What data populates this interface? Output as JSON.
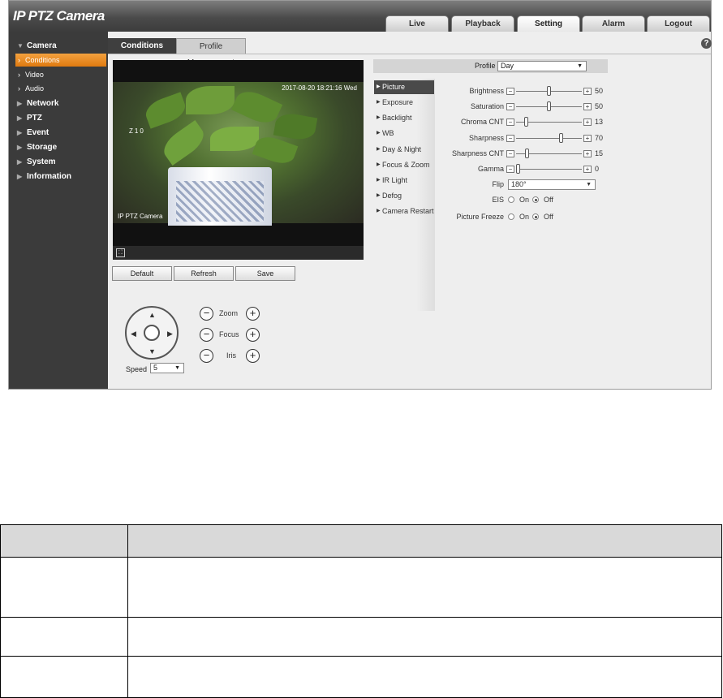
{
  "app": {
    "title": "IP PTZ Camera"
  },
  "nav": {
    "tabs": [
      "Live",
      "Playback",
      "Setting",
      "Alarm",
      "Logout"
    ],
    "active": "Setting"
  },
  "sidebar": {
    "camera": "Camera",
    "subs": [
      "Conditions",
      "Video",
      "Audio"
    ],
    "items": [
      "Network",
      "PTZ",
      "Event",
      "Storage",
      "System",
      "Information"
    ]
  },
  "tabs": {
    "conditions": "Conditions",
    "profile": "Profile Management"
  },
  "video": {
    "timestamp": "2017-08-20 18:21:16 Wed",
    "zoom": "Z10",
    "name": "IP PTZ Camera"
  },
  "buttons": {
    "default": "Default",
    "refresh": "Refresh",
    "save": "Save"
  },
  "ptz": {
    "zoom": "Zoom",
    "focus": "Focus",
    "iris": "Iris",
    "speed_label": "Speed",
    "speed": "5"
  },
  "profile": {
    "label": "Profile",
    "value": "Day"
  },
  "menu": [
    "Picture",
    "Exposure",
    "Backlight",
    "WB",
    "Day & Night",
    "Focus & Zoom",
    "IR Light",
    "Defog",
    "Camera Restart"
  ],
  "settings": {
    "brightness": {
      "label": "Brightness",
      "value": "50",
      "level": 50
    },
    "saturation": {
      "label": "Saturation",
      "value": "50",
      "level": 50
    },
    "chroma": {
      "label": "Chroma CNT",
      "value": "13",
      "level": 13
    },
    "sharpness": {
      "label": "Sharpness",
      "value": "70",
      "level": 70
    },
    "sharpness_cnt": {
      "label": "Sharpness CNT",
      "value": "15",
      "level": 15
    },
    "gamma": {
      "label": "Gamma",
      "value": "0",
      "level": 0
    },
    "flip": {
      "label": "Flip",
      "value": "180°"
    },
    "eis": {
      "label": "EIS",
      "on": "On",
      "off": "Off",
      "selected": "Off"
    },
    "freeze": {
      "label": "Picture Freeze",
      "on": "On",
      "off": "Off",
      "selected": "Off"
    }
  }
}
